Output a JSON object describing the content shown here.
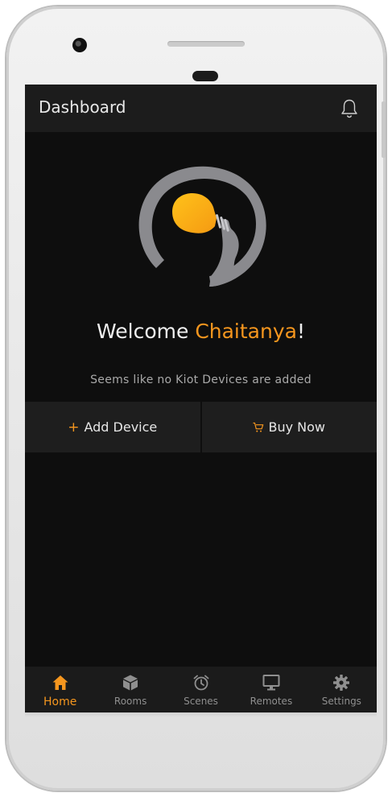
{
  "header": {
    "title": "Dashboard"
  },
  "welcome": {
    "prefix": "Welcome ",
    "name": "Chaitanya",
    "suffix": "!"
  },
  "subtitle": "Seems like no Kiot Devices are added",
  "actions": {
    "add_symbol": "+",
    "add_label": "Add Device",
    "buy_label": "Buy Now"
  },
  "nav": [
    {
      "label": "Home",
      "icon": "home-icon",
      "active": true
    },
    {
      "label": "Rooms",
      "icon": "cube-icon"
    },
    {
      "label": "Scenes",
      "icon": "alarm-clock-icon"
    },
    {
      "label": "Remotes",
      "icon": "monitor-icon"
    },
    {
      "label": "Settings",
      "icon": "gear-icon"
    }
  ],
  "colors": {
    "accent": "#f5961e",
    "background": "#0e0e0e",
    "bar": "#1c1c1c",
    "muted": "#8f8f8f"
  }
}
